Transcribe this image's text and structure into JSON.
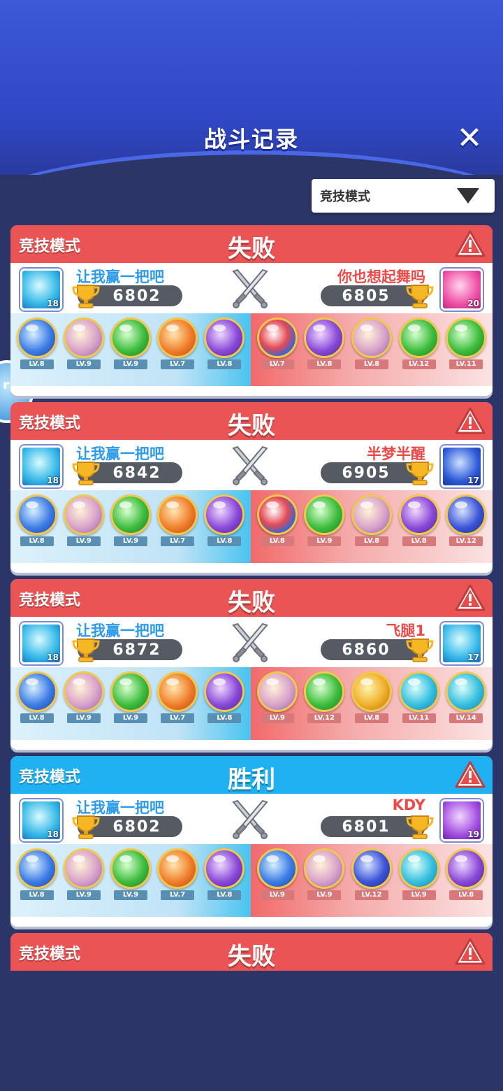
{
  "header": {
    "title": "战斗记录",
    "close_icon": "close-icon"
  },
  "filter": {
    "selected": "竞技模式"
  },
  "colors": {
    "lose": "#ea5455",
    "win": "#1fb1f2",
    "bg": "#2c3568"
  },
  "matches": [
    {
      "mode": "竞技模式",
      "result": "失败",
      "left": {
        "name": "让我赢一把吧",
        "score": "6802",
        "level": "18"
      },
      "right": {
        "name": "你也想起舞吗",
        "score": "6805",
        "level": "20"
      },
      "left_skills": [
        "LV.8",
        "LV.9",
        "LV.9",
        "LV.7",
        "LV.8"
      ],
      "right_skills": [
        "LV.7",
        "LV.8",
        "LV.8",
        "LV.12",
        "LV.11"
      ]
    },
    {
      "mode": "竞技模式",
      "result": "失败",
      "left": {
        "name": "让我赢一把吧",
        "score": "6842",
        "level": "18"
      },
      "right": {
        "name": "半梦半醒",
        "score": "6905",
        "level": "17"
      },
      "left_skills": [
        "LV.8",
        "LV.9",
        "LV.9",
        "LV.7",
        "LV.8"
      ],
      "right_skills": [
        "LV.8",
        "LV.9",
        "LV.8",
        "LV.8",
        "LV.12"
      ]
    },
    {
      "mode": "竞技模式",
      "result": "失败",
      "left": {
        "name": "让我赢一把吧",
        "score": "6872",
        "level": "18"
      },
      "right": {
        "name": "飞腿1",
        "score": "6860",
        "level": "17"
      },
      "left_skills": [
        "LV.8",
        "LV.9",
        "LV.9",
        "LV.7",
        "LV.8"
      ],
      "right_skills": [
        "LV.9",
        "LV.12",
        "LV.8",
        "LV.11",
        "LV.14"
      ]
    },
    {
      "mode": "竞技模式",
      "result": "胜利",
      "left": {
        "name": "让我赢一把吧",
        "score": "6802",
        "level": "18"
      },
      "right": {
        "name": "KDY",
        "score": "6801",
        "level": "19"
      },
      "left_skills": [
        "LV.8",
        "LV.9",
        "LV.9",
        "LV.7",
        "LV.8"
      ],
      "right_skills": [
        "LV.9",
        "LV.9",
        "LV.12",
        "LV.9",
        "LV.8"
      ]
    },
    {
      "mode": "竞技模式",
      "result": "失败"
    }
  ]
}
